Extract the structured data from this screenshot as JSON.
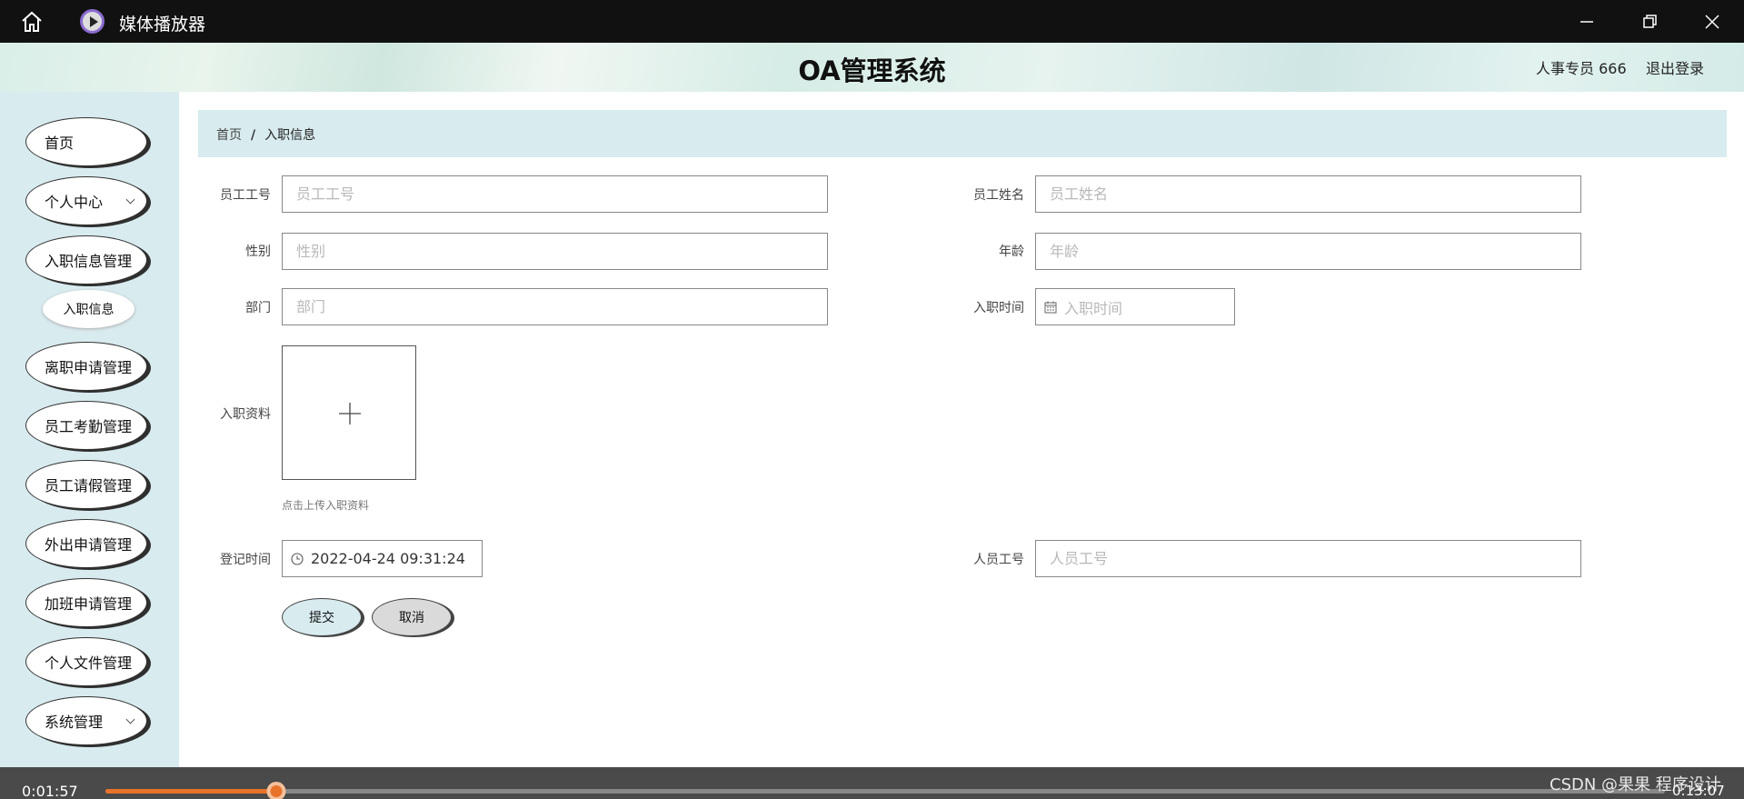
{
  "window": {
    "title": "媒体播放器"
  },
  "header": {
    "title": "OA管理系统",
    "user": "人事专员 666",
    "logout": "退出登录"
  },
  "sidebar": {
    "items": [
      {
        "label": "首页"
      },
      {
        "label": "个人中心"
      },
      {
        "label": "入职信息管理"
      },
      {
        "label": "离职申请管理"
      },
      {
        "label": "员工考勤管理"
      },
      {
        "label": "员工请假管理"
      },
      {
        "label": "外出申请管理"
      },
      {
        "label": "加班申请管理"
      },
      {
        "label": "个人文件管理"
      },
      {
        "label": "系统管理"
      }
    ],
    "sub_item": "入职信息"
  },
  "breadcrumb": {
    "home": "首页",
    "sep": "/",
    "current": "入职信息"
  },
  "form": {
    "emp_no": {
      "label": "员工工号",
      "placeholder": "员工工号"
    },
    "emp_name": {
      "label": "员工姓名",
      "placeholder": "员工姓名"
    },
    "gender": {
      "label": "性别",
      "placeholder": "性别"
    },
    "age": {
      "label": "年龄",
      "placeholder": "年龄"
    },
    "dept": {
      "label": "部门",
      "placeholder": "部门"
    },
    "entry_time": {
      "label": "入职时间",
      "placeholder": "入职时间"
    },
    "materials": {
      "label": "入职资料",
      "hint": "点击上传入职资料"
    },
    "reg_time": {
      "label": "登记时间",
      "value": "2022-04-24 09:31:24"
    },
    "staff_no": {
      "label": "人员工号",
      "placeholder": "人员工号"
    },
    "submit": "提交",
    "cancel": "取消"
  },
  "player": {
    "current_time": "0:01:57",
    "total_time": "0:13:07",
    "progress": 0.1095,
    "watermark": "CSDN @果果 程序设计"
  }
}
